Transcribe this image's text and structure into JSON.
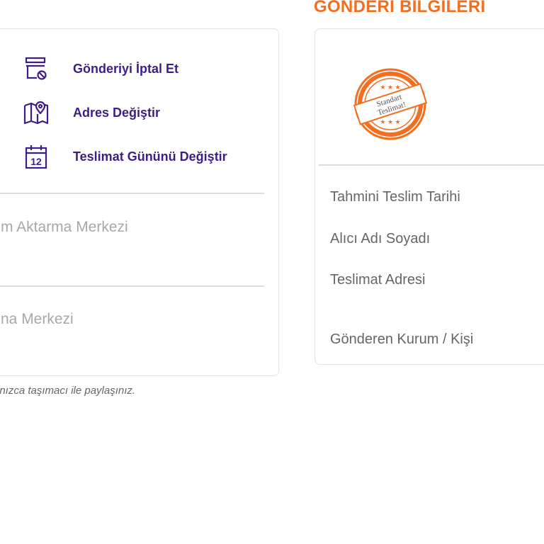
{
  "actions": [
    {
      "label": "Gönderiyi İptal Et",
      "icon": "cancel-shipment-icon"
    },
    {
      "label": "Adres Değiştir",
      "icon": "map-pin-icon"
    },
    {
      "label": "Teslimat Gününü Değiştir",
      "icon": "calendar-12-icon"
    }
  ],
  "calendar_day": "12",
  "centers": [
    {
      "name": "m Aktarma Merkezi"
    },
    {
      "name": "na Merkezi"
    }
  ],
  "footnote": "lnızca taşımacı ile paylaşınız.",
  "section": {
    "title": "GÖNDERİ BİLGİLERİ"
  },
  "stamp": {
    "line1": "Standart",
    "line2": "Teslimat!"
  },
  "info_labels": [
    "Tahmini Teslim Tarihi",
    "Alıcı Adı Soyadı",
    "Teslimat Adresi",
    "Gönderen Kurum / Kişi"
  ],
  "colors": {
    "accent": "#f26f21",
    "action_text": "#3f1d89",
    "muted": "#a8a8a8"
  }
}
